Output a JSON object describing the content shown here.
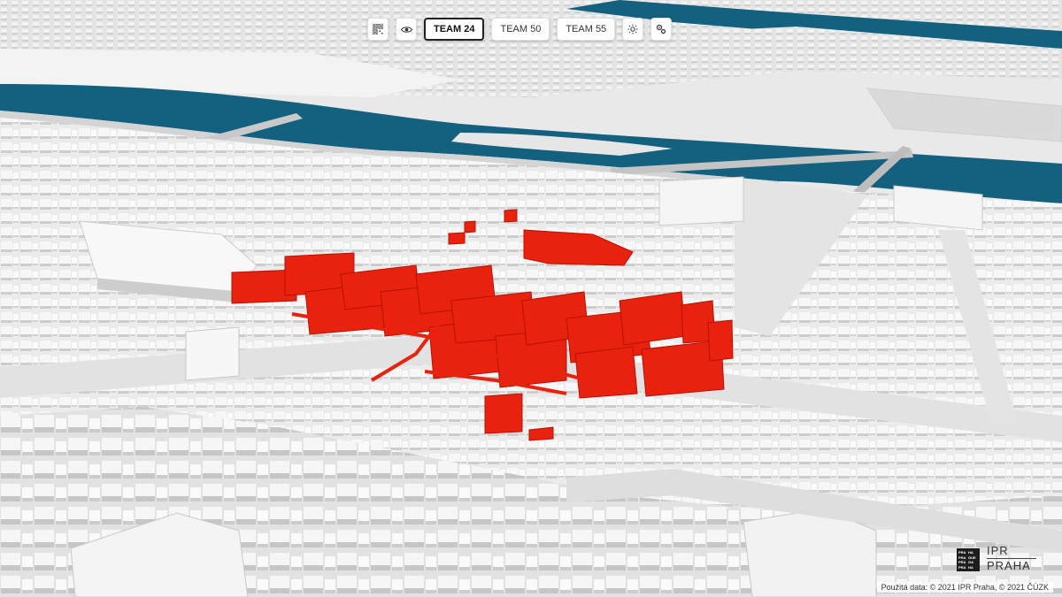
{
  "toolbar": {
    "qr_icon": "qr-code-icon",
    "eye_icon": "eye-icon",
    "teams": [
      {
        "label": "TEAM 24",
        "active": true
      },
      {
        "label": "TEAM 50",
        "active": false
      },
      {
        "label": "TEAM 55",
        "active": false
      }
    ],
    "sun_icon": "sun-icon",
    "settings_icon": "settings-icon"
  },
  "logo": {
    "mark_lines": [
      "PRA",
      "HA",
      "PRA",
      "GUE",
      "PRA",
      "GA",
      "PRA",
      "HA"
    ],
    "top": "IPR",
    "bottom": "PRAHA"
  },
  "attribution": "Použitá data: © 2021 IPR Praha, © 2021 ČÚZK",
  "colors": {
    "river": "#13607f",
    "buildings": "#f4f4f4",
    "highlight": "#e8220f",
    "ground": "#e9e9e9"
  }
}
